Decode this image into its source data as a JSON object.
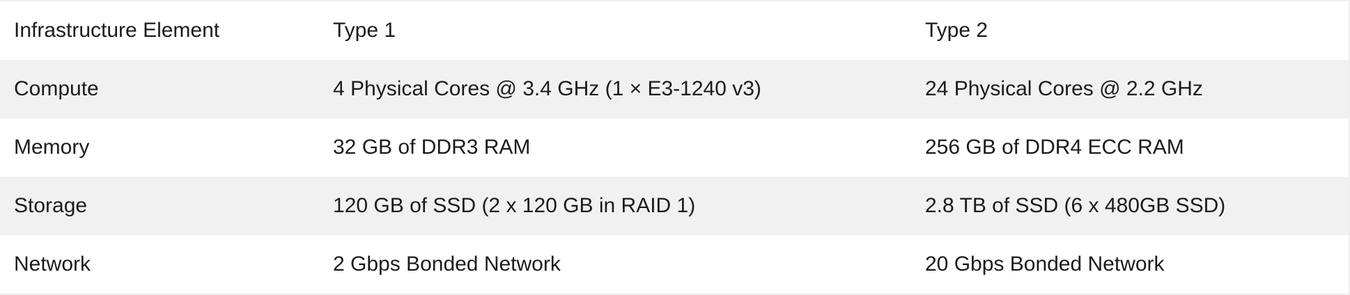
{
  "table": {
    "headers": [
      "Infrastructure Element",
      "Type 1",
      "Type 2"
    ],
    "rows": [
      [
        "Compute",
        "4 Physical Cores @ 3.4 GHz (1 × E3-1240 v3)",
        "24 Physical Cores @ 2.2 GHz"
      ],
      [
        "Memory",
        "32 GB of DDR3 RAM",
        "256 GB of DDR4 ECC RAM"
      ],
      [
        "Storage",
        "120 GB of SSD (2 x 120 GB in RAID 1)",
        "2.8 TB of SSD (6 x 480GB SSD)"
      ],
      [
        "Network",
        "2 Gbps Bonded Network",
        "20 Gbps Bonded Network"
      ]
    ]
  },
  "colors": {
    "stripe": "#f1f1f1",
    "background": "#ffffff",
    "text": "#1b1b1b"
  }
}
